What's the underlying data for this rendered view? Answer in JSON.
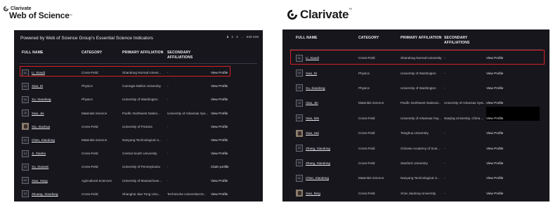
{
  "brands": {
    "left_company": "Clarivate",
    "left_product": "Web of Science",
    "trademark": "™",
    "right_company": "Clarivate"
  },
  "left_panel": {
    "powered_by": "Powered by Web of Science Group's Essential Science Indicators",
    "pager": [
      "1",
      "2",
      "3",
      "...",
      "638 639"
    ],
    "headers": {
      "full_name": "FULL NAME",
      "category": "CATEGORY",
      "primary": "PRIMARY AFFILIATION",
      "secondary": "SECONDARY AFFILIATIONS"
    },
    "rows": [
      {
        "initials": "XL",
        "name": "Li, Xiaodi",
        "category": "Cross-Field",
        "primary": "Shandong Normal Univer...",
        "secondary": "-",
        "link": "View Profile",
        "photo": false
      },
      {
        "initials": "DX",
        "name": "Xiao, Di",
        "category": "Physics",
        "primary": "Carnegie Mellon University",
        "secondary": "-",
        "link": "View Profile",
        "photo": false
      },
      {
        "initials": "XX",
        "name": "Xu, Xiaodong",
        "category": "Physics",
        "primary": "University of Washington",
        "secondary": "-",
        "link": "View Profile",
        "photo": false
      },
      {
        "initials": "JX",
        "name": "Xiao, Jie",
        "category": "Materials Science",
        "primary": "Pacific Northwest Nation...",
        "secondary": "University of Arkansas Sys...",
        "link": "View Profile",
        "photo": false
      },
      {
        "initials": "",
        "name": "Xia, Xiaohua",
        "category": "Cross-Field",
        "primary": "University of Pretoria",
        "secondary": "-",
        "link": "View Profile",
        "photo": true
      },
      {
        "initials": "XC",
        "name": "Chen, Xiaodong",
        "category": "Materials Science",
        "primary": "Nanyang Technological U...",
        "secondary": "-",
        "link": "View Profile",
        "photo": false
      },
      {
        "initials": "XJ",
        "name": "Ji, Xiaobo",
        "category": "Cross-Field",
        "primary": "Central South University",
        "secondary": "-",
        "link": "View Profile",
        "photo": false
      },
      {
        "initials": "XX",
        "name": "Xu, Xiaowei",
        "category": "Cross-Field",
        "primary": "University of Pennsylvania",
        "secondary": "-",
        "link": "Claim profile",
        "photo": false
      },
      {
        "initials": "HX",
        "name": "Xiao, Hang",
        "category": "Agricultural Sciences",
        "primary": "University of Massachuse...",
        "secondary": "-",
        "link": "View Profile",
        "photo": false
      },
      {
        "initials": "XZ",
        "name": "Zhuang, Xiaodong",
        "category": "Cross-Field",
        "primary": "Shanghai Jiao Tong Univ...",
        "secondary": "Technische Universitat Dr...",
        "link": "View Profile",
        "photo": false
      }
    ]
  },
  "right_panel": {
    "headers": {
      "full_name": "FULL NAME",
      "category": "CATEGORY",
      "primary": "PRIMARY AFFILIATION",
      "secondary": "SECONDARY AFFILIATIONS"
    },
    "rows": [
      {
        "initials": "XL",
        "name": "Li, Xiaodi",
        "category": "Cross-Field",
        "primary": "Shandong Normal University",
        "secondary": "-",
        "link": "View Profile",
        "photo": false
      },
      {
        "initials": "DX",
        "name": "Xiao, Di",
        "category": "Physics",
        "primary": "University of Washington",
        "secondary": "-",
        "link": "View Profile",
        "photo": false
      },
      {
        "initials": "XX",
        "name": "Xu, Xiaodong",
        "category": "Physics",
        "primary": "University of Washington",
        "secondary": "-",
        "link": "View Profile",
        "photo": false
      },
      {
        "initials": "JX",
        "name": "Xiao, Jie",
        "category": "Materials Science",
        "primary": "Pacific Northwest National...",
        "secondary": "University of Arkansas Syst...",
        "link": "View Profile",
        "photo": false
      },
      {
        "initials": "MX",
        "name": "Xiao, Min",
        "category": "Cross-Field",
        "primary": "University of Arkansas Fay...",
        "secondary": "Nanjing University, China ...",
        "link": "View Profile",
        "photo": false
      },
      {
        "initials": "",
        "name": "Xiao, Hai",
        "category": "Cross-Field",
        "primary": "Tsinghua University",
        "secondary": "-",
        "link": "View Profile",
        "photo": true
      },
      {
        "initials": "XZ",
        "name": "Zhang, Xiaodong",
        "category": "Cross-Field",
        "primary": "Chinese Academy of Scie...",
        "secondary": "-",
        "link": "View Profile",
        "photo": false
      },
      {
        "initials": "XZ",
        "name": "Zhang, Xiaodong",
        "category": "Cross-Field",
        "primary": "Stanford University",
        "secondary": "-",
        "link": "View Profile",
        "photo": false
      },
      {
        "initials": "XC",
        "name": "Chen, Xiaodong",
        "category": "Materials Science",
        "primary": "Nanyang Technological U...",
        "secondary": "-",
        "link": "View Profile",
        "photo": false
      },
      {
        "initials": "",
        "name": "Xiao, Bing",
        "category": "Cross-Field",
        "primary": "Xi'an Jiaotong University",
        "secondary": "-",
        "link": "View Profile",
        "photo": true
      }
    ]
  },
  "colors": {
    "panel_bg": "#16161c",
    "highlight": "#d91f26"
  }
}
